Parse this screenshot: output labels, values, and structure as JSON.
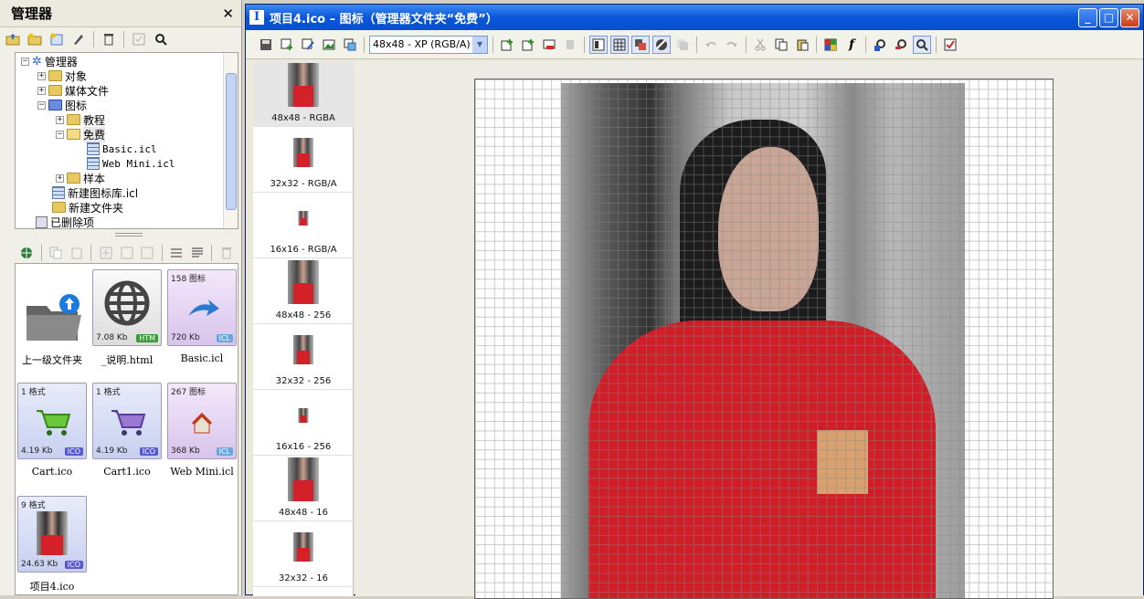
{
  "manager": {
    "title": "管理器",
    "close": "✕",
    "tree": [
      {
        "label": "管理器",
        "icon": "manager-icon"
      },
      {
        "label": "对象",
        "icon": "folder-icon"
      },
      {
        "label": "媒体文件",
        "icon": "folder-icon"
      },
      {
        "label": "图标",
        "icon": "folder-icon"
      },
      {
        "label": "教程",
        "icon": "folder-icon"
      },
      {
        "label": "免费",
        "icon": "folder-open-icon"
      },
      {
        "label": "Basic.icl",
        "icon": "icon-library-icon"
      },
      {
        "label": "Web Mini.icl",
        "icon": "icon-library-icon"
      },
      {
        "label": "样本",
        "icon": "folder-icon"
      },
      {
        "label": "新建图标库.icl",
        "icon": "icon-library-icon"
      },
      {
        "label": "新建文件夹",
        "icon": "folder-icon"
      },
      {
        "label": "已删除项",
        "icon": "recycle-bin-icon"
      }
    ],
    "files": [
      {
        "name": "上一级文件夹",
        "top": "",
        "size": "",
        "badge": ""
      },
      {
        "name": "_说明.html",
        "top": "",
        "size": "7.08 Kb",
        "badge": "HTM"
      },
      {
        "name": "Basic.icl",
        "top": "158 图标",
        "size": "720 Kb",
        "badge": "ICL"
      },
      {
        "name": "Cart.ico",
        "top": "1 格式",
        "size": "4.19 Kb",
        "badge": "ICO"
      },
      {
        "name": "Cart1.ico",
        "top": "1 格式",
        "size": "4.19 Kb",
        "badge": "ICO"
      },
      {
        "name": "Web Mini.icl",
        "top": "267 图标",
        "size": "368 Kb",
        "badge": "ICL"
      },
      {
        "name": "项目4.ico",
        "top": "9 格式",
        "size": "24.63 Kb",
        "badge": "ICO"
      }
    ]
  },
  "editor": {
    "title": "项目4.ico – 图标（管理器文件夹“免费”）",
    "title_icon": "I",
    "format_select": "48x48 - XP (RGB/A)",
    "window_buttons": {
      "minimize": "_",
      "maximize": "□",
      "close": "✕"
    },
    "formats": [
      {
        "label": "48x48 - RGBA"
      },
      {
        "label": "32x32 - RGB/A"
      },
      {
        "label": "16x16 - RGB/A"
      },
      {
        "label": "48x48 - 256"
      },
      {
        "label": "32x32 - 256"
      },
      {
        "label": "16x16 - 256"
      },
      {
        "label": "48x48 - 16"
      },
      {
        "label": "32x32 - 16"
      }
    ]
  },
  "colors": {
    "titlebar": "#0a56d8",
    "shirt": "#cf1e28",
    "badge_ico": "#5a5ad0",
    "badge_icl": "#6aa6d8",
    "badge_htm": "#3a9a3a"
  }
}
